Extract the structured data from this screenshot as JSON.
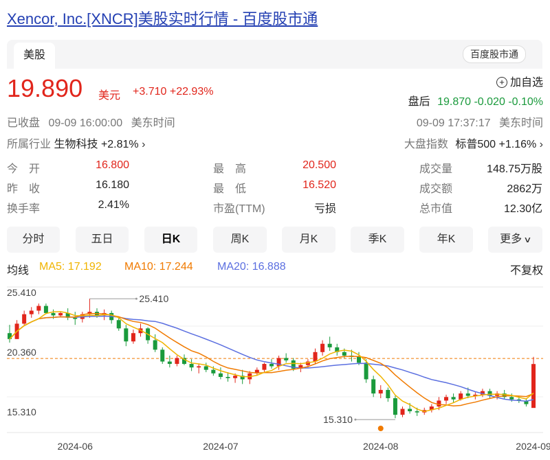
{
  "page": {
    "title": "Xencor, Inc.[XNCR]美股实时行情 - 百度股市通",
    "market_tab": "美股",
    "source_badge": "百度股市通"
  },
  "quote": {
    "price": "19.890",
    "currency": "美元",
    "change": "+3.710",
    "change_pct": "+22.93%",
    "close_status": "已收盘",
    "close_time": "09-09 16:00:00",
    "timezone": "美东时间",
    "watchlist_label": "加自选",
    "after_hours_label": "盘后",
    "after_hours_price": "19.870",
    "after_hours_change": "-0.020",
    "after_hours_change_pct": "-0.10%",
    "after_hours_time": "09-09 17:37:17",
    "after_hours_timezone": "美东时间"
  },
  "industry": {
    "label": "所属行业",
    "name": "生物科技",
    "change": "+2.81%",
    "index_label": "大盘指数",
    "index_name": "标普500",
    "index_change": "+1.16%"
  },
  "stats": {
    "open_label": "今　开",
    "open": "16.800",
    "prev_close_label": "昨　收",
    "prev_close": "16.180",
    "turnover_label": "换手率",
    "turnover": "2.41%",
    "high_label": "最　高",
    "high": "20.500",
    "low_label": "最　低",
    "low": "16.520",
    "pe_label": "市盈(TTM)",
    "pe": "亏损",
    "volume_label": "成交量",
    "volume": "148.75万股",
    "amount_label": "成交额",
    "amount": "2862万",
    "mktcap_label": "总市值",
    "mktcap": "12.30亿"
  },
  "periods": {
    "minute": "分时",
    "five_day": "五日",
    "day": "日K",
    "week": "周K",
    "month": "月K",
    "quarter": "季K",
    "year": "年K",
    "more": "更多"
  },
  "legend": {
    "ma_label": "均线",
    "ma5": "MA5: 17.192",
    "ma10": "MA10: 17.244",
    "ma20": "MA20: 16.888",
    "adjust": "不复权"
  },
  "colors": {
    "up": "#e1251b",
    "down": "#1a9a3c",
    "ma5": "#f0b400",
    "ma10": "#f07a00",
    "ma20": "#5b6fe0",
    "ref_line": "#f07a00"
  },
  "chart_data": {
    "type": "candlestick",
    "y_ticks": [
      "25.410",
      "20.360",
      "15.310"
    ],
    "y_range": [
      14.1,
      26.4
    ],
    "ref_price": 20.36,
    "x_ticks": [
      {
        "label": "2024-06",
        "index": 9
      },
      {
        "label": "2024-07",
        "index": 29
      },
      {
        "label": "2024-08",
        "index": 51
      },
      {
        "label": "2024-09",
        "index": 72
      }
    ],
    "max_label": "25.410",
    "max_value": 25.41,
    "max_index": 11,
    "min_label": "15.310",
    "min_value": 15.31,
    "min_index": 53,
    "candles": [
      [
        22.5,
        23.2,
        21.7,
        22.0
      ],
      [
        22.0,
        23.6,
        22.0,
        23.3
      ],
      [
        23.3,
        24.4,
        23.2,
        24.1
      ],
      [
        24.1,
        24.7,
        23.8,
        24.4
      ],
      [
        24.4,
        25.0,
        24.1,
        24.8
      ],
      [
        24.8,
        25.0,
        24.1,
        24.2
      ],
      [
        24.2,
        24.5,
        23.7,
        24.0
      ],
      [
        24.0,
        24.3,
        23.9,
        24.2
      ],
      [
        24.2,
        24.6,
        23.6,
        23.8
      ],
      [
        23.8,
        24.3,
        23.2,
        23.7
      ],
      [
        23.7,
        24.3,
        23.4,
        24.1
      ],
      [
        24.1,
        25.41,
        23.8,
        24.3
      ],
      [
        24.3,
        24.6,
        23.8,
        24.0
      ],
      [
        24.0,
        24.5,
        23.6,
        24.2
      ],
      [
        24.2,
        24.4,
        23.3,
        23.6
      ],
      [
        23.6,
        23.9,
        22.7,
        22.9
      ],
      [
        22.9,
        23.2,
        21.4,
        21.8
      ],
      [
        21.8,
        22.8,
        21.6,
        22.5
      ],
      [
        22.5,
        23.3,
        22.2,
        22.9
      ],
      [
        22.9,
        23.0,
        21.6,
        21.9
      ],
      [
        21.9,
        22.4,
        20.9,
        21.1
      ],
      [
        21.1,
        21.3,
        19.9,
        20.1
      ],
      [
        20.1,
        20.6,
        19.6,
        19.9
      ],
      [
        19.9,
        20.6,
        19.7,
        20.4
      ],
      [
        20.4,
        20.7,
        19.8,
        19.9
      ],
      [
        19.9,
        20.3,
        19.3,
        19.6
      ],
      [
        19.6,
        19.9,
        19.1,
        19.7
      ],
      [
        19.7,
        20.0,
        19.2,
        19.4
      ],
      [
        19.4,
        19.7,
        18.9,
        19.1
      ],
      [
        19.1,
        19.6,
        18.6,
        18.8
      ],
      [
        18.8,
        19.2,
        18.4,
        18.7
      ],
      [
        18.7,
        19.1,
        18.3,
        18.9
      ],
      [
        18.9,
        19.4,
        18.2,
        18.6
      ],
      [
        18.6,
        19.3,
        18.2,
        19.1
      ],
      [
        19.1,
        19.6,
        18.9,
        19.4
      ],
      [
        19.4,
        20.0,
        19.2,
        19.9
      ],
      [
        19.9,
        20.3,
        19.5,
        19.7
      ],
      [
        19.7,
        20.6,
        19.4,
        20.4
      ],
      [
        20.4,
        20.8,
        20.0,
        20.2
      ],
      [
        20.2,
        20.4,
        19.3,
        19.5
      ],
      [
        19.5,
        20.0,
        19.2,
        19.8
      ],
      [
        19.8,
        20.3,
        19.6,
        20.1
      ],
      [
        20.1,
        21.2,
        19.9,
        20.9
      ],
      [
        20.9,
        21.9,
        20.6,
        21.6
      ],
      [
        21.6,
        22.2,
        21.0,
        21.3
      ],
      [
        21.3,
        21.6,
        20.6,
        20.9
      ],
      [
        20.9,
        21.2,
        20.4,
        20.6
      ],
      [
        20.6,
        21.1,
        20.1,
        20.5
      ],
      [
        20.5,
        20.9,
        19.8,
        20.0
      ],
      [
        20.0,
        20.3,
        18.3,
        18.6
      ],
      [
        18.6,
        18.9,
        17.1,
        17.4
      ],
      [
        17.4,
        18.1,
        17.0,
        17.7
      ],
      [
        17.7,
        17.9,
        16.7,
        17.0
      ],
      [
        17.0,
        17.2,
        15.31,
        15.6
      ],
      [
        15.6,
        16.3,
        15.4,
        16.1
      ],
      [
        16.1,
        16.6,
        15.7,
        15.9
      ],
      [
        15.9,
        16.2,
        15.5,
        15.8
      ],
      [
        15.8,
        16.2,
        15.6,
        16.0
      ],
      [
        16.0,
        16.5,
        15.8,
        16.3
      ],
      [
        16.3,
        17.1,
        16.0,
        16.8
      ],
      [
        16.8,
        17.3,
        16.5,
        17.1
      ],
      [
        17.1,
        17.4,
        16.6,
        16.9
      ],
      [
        16.9,
        17.6,
        16.8,
        17.4
      ],
      [
        17.4,
        17.9,
        17.0,
        17.2
      ],
      [
        17.2,
        17.5,
        16.9,
        17.3
      ],
      [
        17.3,
        17.8,
        17.1,
        17.6
      ],
      [
        17.6,
        17.8,
        17.0,
        17.2
      ],
      [
        17.2,
        17.6,
        16.9,
        17.4
      ],
      [
        17.4,
        17.7,
        16.9,
        17.1
      ],
      [
        17.1,
        17.4,
        16.7,
        16.9
      ],
      [
        16.9,
        17.2,
        16.6,
        16.8
      ],
      [
        16.8,
        17.0,
        16.3,
        16.5
      ],
      [
        16.18,
        20.5,
        16.52,
        19.89
      ]
    ]
  }
}
